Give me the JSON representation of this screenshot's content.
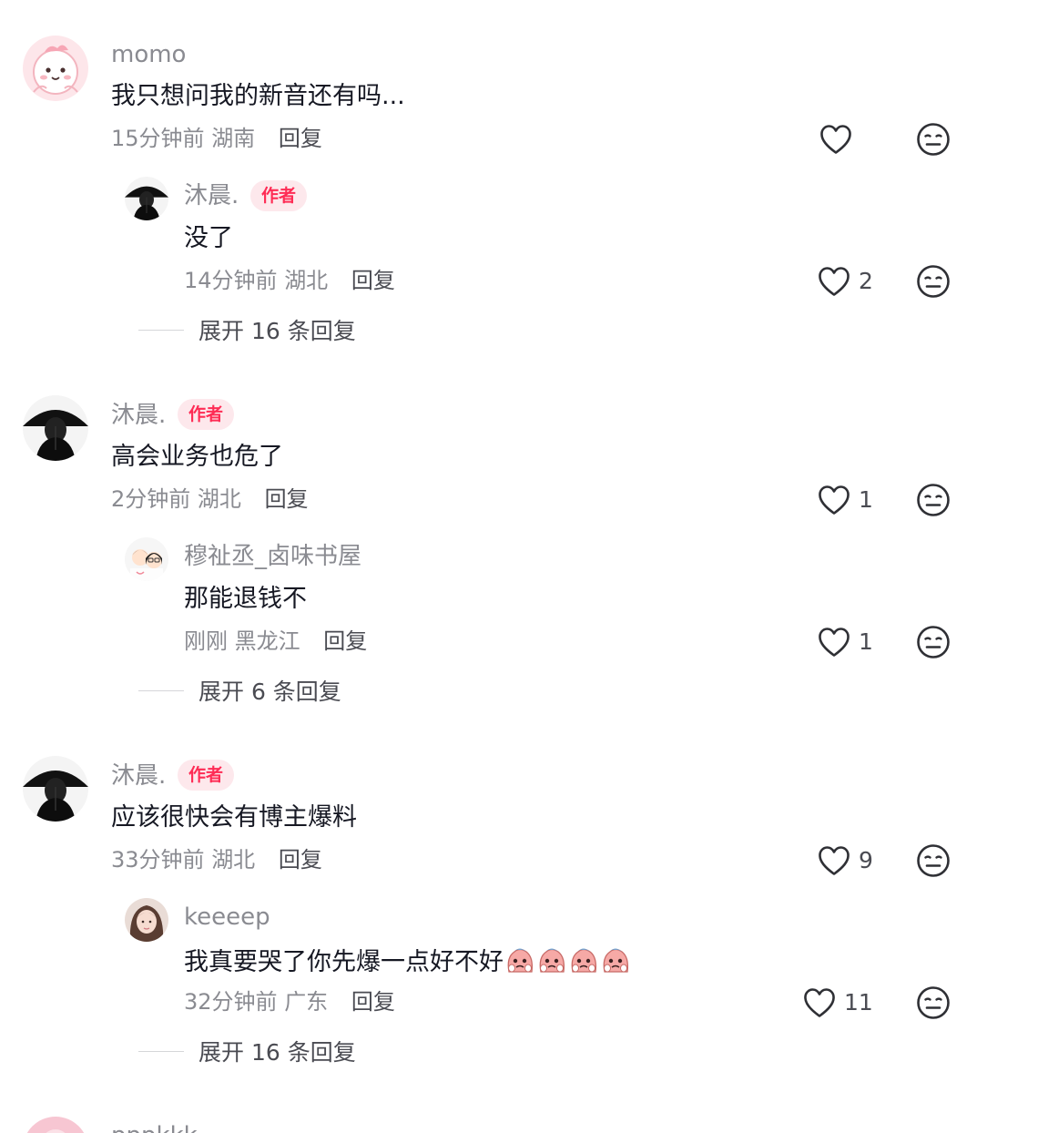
{
  "colors": {
    "accent": "#fe2c55",
    "badge_bg": "#fde8ec",
    "muted": "#8a8b91",
    "text": "#161823"
  },
  "comments": [
    {
      "user": "momo",
      "avatar_icon": "pink-cartoon-avatar",
      "text": "我只想问我的新音还有吗...",
      "time": "15分钟前",
      "location": "湖南",
      "reply_label": "回复",
      "likes": "",
      "reply": {
        "user": "沐晨.",
        "avatar_icon": "dark-umbrella-avatar",
        "badge": "作者",
        "text": "没了",
        "time": "14分钟前",
        "location": "湖北",
        "reply_label": "回复",
        "likes": "2"
      },
      "expand_label": "展开 16 条回复"
    },
    {
      "user": "沐晨.",
      "avatar_icon": "dark-umbrella-avatar",
      "badge": "作者",
      "text": "高会业务也危了",
      "time": "2分钟前",
      "location": "湖北",
      "reply_label": "回复",
      "likes": "1",
      "reply": {
        "user": "穆祉丞_卤味书屋",
        "avatar_icon": "cartoon-couple-avatar",
        "text": "那能退钱不",
        "time": "刚刚",
        "location": "黑龙江",
        "reply_label": "回复",
        "likes": "1"
      },
      "expand_label": "展开 6 条回复"
    },
    {
      "user": "沐晨.",
      "avatar_icon": "dark-umbrella-avatar",
      "badge": "作者",
      "text": "应该很快会有博主爆料",
      "time": "33分钟前",
      "location": "湖北",
      "reply_label": "回复",
      "likes": "9",
      "reply": {
        "user": "keeeep",
        "avatar_icon": "girl-photo-avatar",
        "text": "我真要哭了你先爆一点好不好",
        "emojis": [
          "crying-emoji",
          "crying-emoji",
          "crying-emoji",
          "crying-emoji"
        ],
        "time": "32分钟前",
        "location": "广东",
        "reply_label": "回复",
        "likes": "11"
      },
      "expand_label": "展开 16 条回复"
    },
    {
      "user": "pppkkk",
      "avatar_icon": "pink-avatar"
    }
  ]
}
